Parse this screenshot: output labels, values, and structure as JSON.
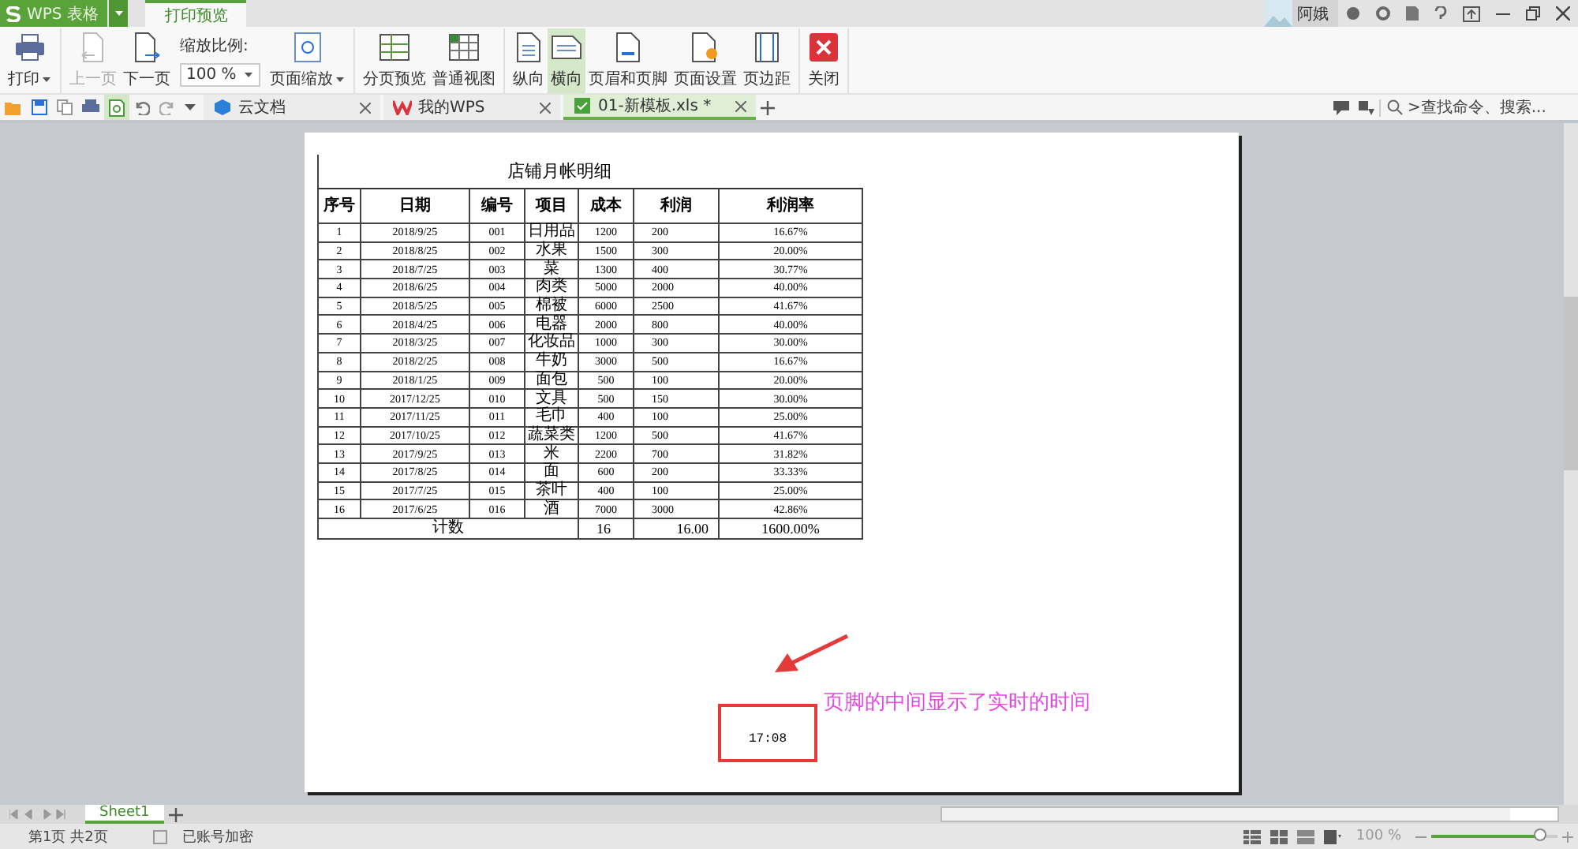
{
  "app": {
    "name": "WPS 表格",
    "tab": "打印预览"
  },
  "user": {
    "name": "阿娥"
  },
  "ribbon": {
    "groups": [
      [
        {
          "kind": "button",
          "label": "打印",
          "dropdown": true,
          "disabled": false,
          "selected": false
        }
      ],
      [
        {
          "kind": "button",
          "label": "上一页",
          "dropdown": false,
          "disabled": true,
          "selected": false
        },
        {
          "kind": "button",
          "label": "下一页",
          "dropdown": false,
          "disabled": false,
          "selected": false
        },
        {
          "kind": "zoom",
          "label": "缩放比例:",
          "value": "100 %"
        },
        {
          "kind": "button",
          "label": "页面缩放",
          "dropdown": true,
          "disabled": false,
          "selected": false
        }
      ],
      [
        {
          "kind": "button",
          "label": "分页预览",
          "dropdown": false,
          "disabled": false,
          "selected": false
        },
        {
          "kind": "button",
          "label": "普通视图",
          "dropdown": false,
          "disabled": false,
          "selected": false
        }
      ],
      [
        {
          "kind": "button",
          "label": "纵向",
          "dropdown": false,
          "disabled": false,
          "selected": false
        },
        {
          "kind": "button",
          "label": "横向",
          "dropdown": false,
          "disabled": false,
          "selected": true
        },
        {
          "kind": "button",
          "label": "页眉和页脚",
          "dropdown": false,
          "disabled": false,
          "selected": false
        },
        {
          "kind": "button",
          "label": "页面设置",
          "dropdown": false,
          "disabled": false,
          "selected": false
        },
        {
          "kind": "button",
          "label": "页边距",
          "dropdown": false,
          "disabled": false,
          "selected": false
        }
      ],
      [
        {
          "kind": "button",
          "label": "关闭",
          "dropdown": false,
          "disabled": false,
          "selected": false
        }
      ]
    ]
  },
  "doc_tabs": [
    {
      "label": "云文档",
      "selected": false
    },
    {
      "label": "我的WPS",
      "selected": false
    },
    {
      "label": "01-新模板.xls *",
      "selected": true
    }
  ],
  "search": {
    "placeholder": ">查找命令、搜索..."
  },
  "sheet": {
    "title": "店铺月帐明细",
    "columns": [
      "序号",
      "日期",
      "编号",
      "项目",
      "成本",
      "利润",
      "利润率"
    ],
    "rows": [
      [
        "1",
        "2018/9/25",
        "001",
        "日用品",
        "1200",
        "200",
        "16.67%"
      ],
      [
        "2",
        "2018/8/25",
        "002",
        "水果",
        "1500",
        "300",
        "20.00%"
      ],
      [
        "3",
        "2018/7/25",
        "003",
        "菜",
        "1300",
        "400",
        "30.77%"
      ],
      [
        "4",
        "2018/6/25",
        "004",
        "肉类",
        "5000",
        "2000",
        "40.00%"
      ],
      [
        "5",
        "2018/5/25",
        "005",
        "棉被",
        "6000",
        "2500",
        "41.67%"
      ],
      [
        "6",
        "2018/4/25",
        "006",
        "电器",
        "2000",
        "800",
        "40.00%"
      ],
      [
        "7",
        "2018/3/25",
        "007",
        "化妆品",
        "1000",
        "300",
        "30.00%"
      ],
      [
        "8",
        "2018/2/25",
        "008",
        "牛奶",
        "3000",
        "500",
        "16.67%"
      ],
      [
        "9",
        "2018/1/25",
        "009",
        "面包",
        "500",
        "100",
        "20.00%"
      ],
      [
        "10",
        "2017/12/25",
        "010",
        "文具",
        "500",
        "150",
        "30.00%"
      ],
      [
        "11",
        "2017/11/25",
        "011",
        "毛巾",
        "400",
        "100",
        "25.00%"
      ],
      [
        "12",
        "2017/10/25",
        "012",
        "蔬菜类",
        "1200",
        "500",
        "41.67%"
      ],
      [
        "13",
        "2017/9/25",
        "013",
        "米",
        "2200",
        "700",
        "31.82%"
      ],
      [
        "14",
        "2017/8/25",
        "014",
        "面",
        "600",
        "200",
        "33.33%"
      ],
      [
        "15",
        "2017/7/25",
        "015",
        "茶叶",
        "400",
        "100",
        "25.00%"
      ],
      [
        "16",
        "2017/6/25",
        "016",
        "酒",
        "7000",
        "3000",
        "42.86%"
      ]
    ],
    "total": [
      "计数",
      "16",
      "16.00",
      "1600.00%"
    ],
    "footer": "17:08"
  },
  "annotation": {
    "text": "页脚的中间显示了实时的时间"
  },
  "sheet_tabs": [
    {
      "label": "Sheet1",
      "selected": true
    }
  ],
  "status": {
    "pages": "第1页 共2页",
    "encryption": "已账号加密",
    "zoom": "100 %",
    "zoom_slider": {
      "level": 0.86
    }
  }
}
